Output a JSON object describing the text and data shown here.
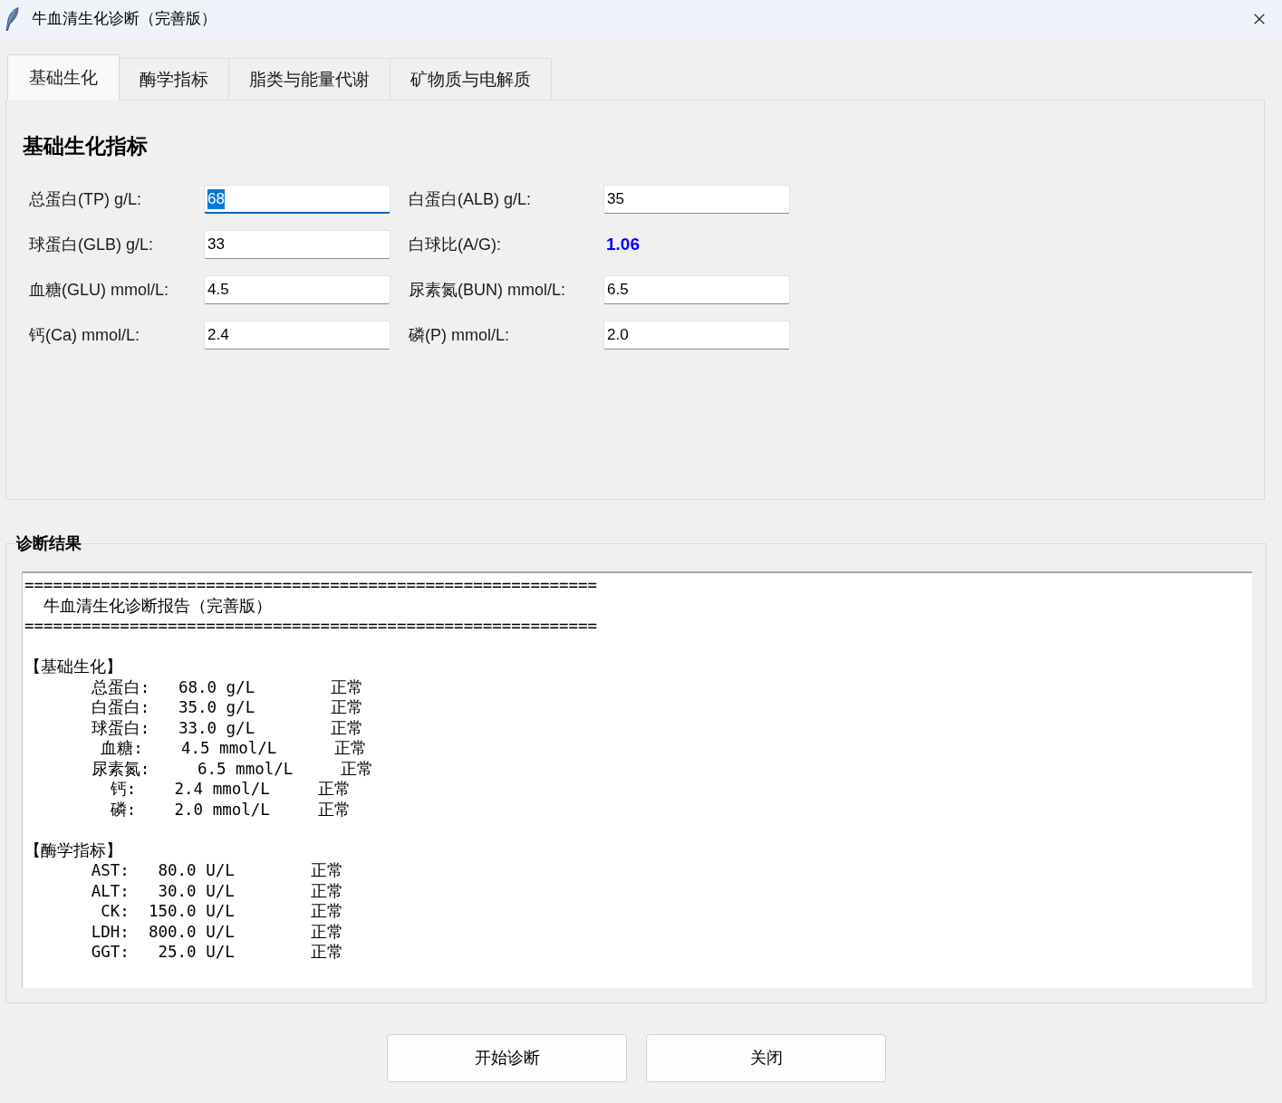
{
  "window": {
    "title": "牛血清生化诊断（完善版）"
  },
  "tabs": [
    {
      "label": "基础生化",
      "selected": true
    },
    {
      "label": "酶学指标",
      "selected": false
    },
    {
      "label": "脂类与能量代谢",
      "selected": false
    },
    {
      "label": "矿物质与电解质",
      "selected": false
    }
  ],
  "panel": {
    "heading": "基础生化指标",
    "fields": [
      {
        "label": "总蛋白(TP) g/L:",
        "kind": "input",
        "value": "68",
        "focused": true
      },
      {
        "label": "白蛋白(ALB) g/L:",
        "kind": "input",
        "value": "35",
        "focused": false
      },
      {
        "label": "球蛋白(GLB) g/L:",
        "kind": "input",
        "value": "33",
        "focused": false
      },
      {
        "label": "白球比(A/G):",
        "kind": "computed",
        "value": "1.06"
      },
      {
        "label": "血糖(GLU) mmol/L:",
        "kind": "input",
        "value": "4.5",
        "focused": false
      },
      {
        "label": "尿素氮(BUN) mmol/L:",
        "kind": "input",
        "value": "6.5",
        "focused": false
      },
      {
        "label": "钙(Ca) mmol/L:",
        "kind": "input",
        "value": "2.4",
        "focused": false
      },
      {
        "label": "磷(P) mmol/L:",
        "kind": "input",
        "value": "2.0",
        "focused": false
      }
    ]
  },
  "results": {
    "title": "诊断结果",
    "header": {
      "top_rule": "============================================================",
      "title": "  牛血清生化诊断报告（完善版）",
      "bottom_rule": "============================================================"
    },
    "sections": [
      {
        "heading": "【基础生化】",
        "lines": [
          "       总蛋白:   68.0 g/L        正常",
          "       白蛋白:   35.0 g/L        正常",
          "       球蛋白:   33.0 g/L        正常",
          "        血糖:    4.5 mmol/L      正常",
          "       尿素氮:     6.5 mmol/L     正常",
          "         钙:    2.4 mmol/L     正常",
          "         磷:    2.0 mmol/L     正常"
        ]
      },
      {
        "heading": "【酶学指标】",
        "lines": [
          "       AST:   80.0 U/L        正常",
          "       ALT:   30.0 U/L        正常",
          "        CK:  150.0 U/L        正常",
          "       LDH:  800.0 U/L        正常",
          "       GGT:   25.0 U/L        正常"
        ]
      }
    ]
  },
  "buttons": [
    {
      "label": "开始诊断"
    },
    {
      "label": "关闭"
    }
  ]
}
